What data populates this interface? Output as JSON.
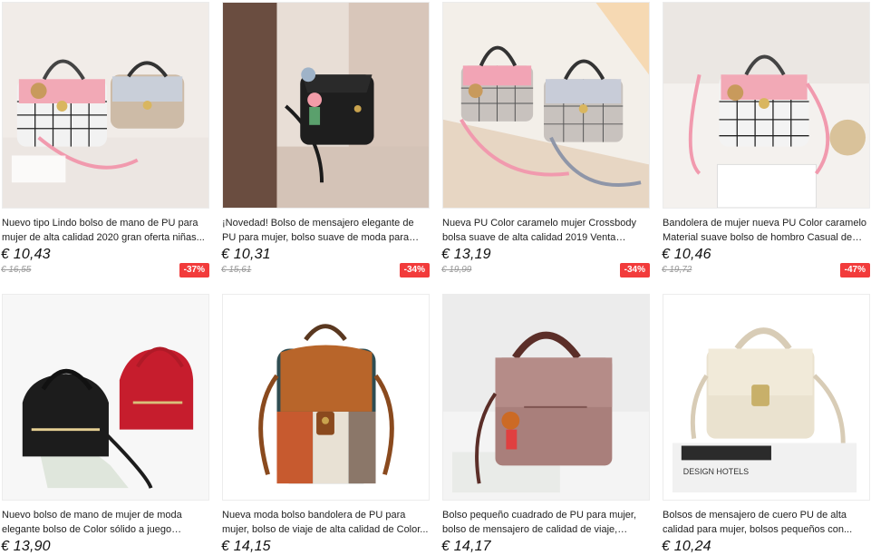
{
  "products": [
    {
      "title": "Nuevo tipo Lindo bolso de mano de PU para mujer de alta calidad 2020 gran oferta niñas...",
      "price": "€ 10,43",
      "old_price": "€ 16,55",
      "discount": "-37%",
      "image": "pink-plaid-handbags-pair"
    },
    {
      "title": "¡Novedad! Bolso de mensajero elegante de PU para mujer, bolso suave de moda para mujer...",
      "price": "€ 10,31",
      "old_price": "€ 15,61",
      "discount": "-34%",
      "image": "black-crossbody-bag"
    },
    {
      "title": "Nueva PU Color caramelo mujer Crossbody bolsa suave de alta calidad 2019 Venta calien...",
      "price": "€ 13,19",
      "old_price": "€ 19,99",
      "discount": "-34%",
      "image": "pink-grey-plaid-bags"
    },
    {
      "title": "Bandolera de mujer nueva PU Color caramelo Material suave bolso de hombro Casual de lu...",
      "price": "€ 10,46",
      "old_price": "€ 19,72",
      "discount": "-47%",
      "image": "pink-plaid-shoulder-bag"
    },
    {
      "title": "Nuevo bolso de mano de mujer de moda elegante bolso de Color sólido a juego bolsas...",
      "price": "€ 13,90",
      "image": "black-red-handbags"
    },
    {
      "title": "Nueva moda bolso bandolera de PU para mujer, bolso de viaje de alta calidad de Color...",
      "price": "€ 14,15",
      "image": "brown-patchwork-backpack"
    },
    {
      "title": "Bolso pequeño cuadrado de PU para mujer, bolso de mensajero de calidad de viaje, bolso...",
      "price": "€ 14,17",
      "image": "mauve-suede-handbag"
    },
    {
      "title": "Bolsos de mensajero de cuero PU de alta calidad para mujer, bolsos pequeños con...",
      "price": "€ 10,24",
      "image": "cream-leather-handbag"
    }
  ],
  "image_text": {
    "hotels_sign": "DESIGN HOTELS"
  },
  "colors": {
    "discount_badge": "#f23b3b",
    "price_text": "#111111",
    "old_price_text": "#999999"
  }
}
